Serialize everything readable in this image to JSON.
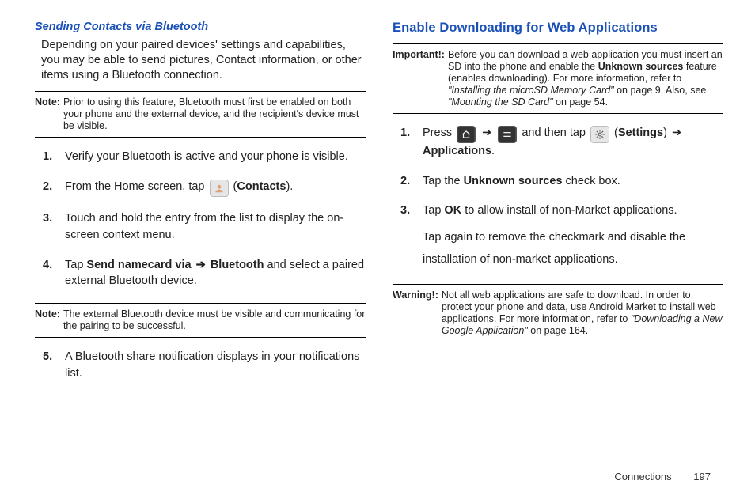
{
  "left": {
    "sub_heading": "Sending Contacts via Bluetooth",
    "intro": "Depending on your paired devices' settings and capabilities, you may be able to send pictures, Contact information, or other items using a Bluetooth connection.",
    "note1_label": "Note:",
    "note1_text": "Prior to using this feature, Bluetooth must first be enabled on both your phone and the external device, and the recipient's device must be visible.",
    "steps": {
      "n1": "1.",
      "s1": "Verify your Bluetooth is active and your phone is visible.",
      "n2": "2.",
      "s2_a": "From the Home screen, tap ",
      "s2_b": " (",
      "s2_bold": "Contacts",
      "s2_c": ").",
      "n3": "3.",
      "s3": "Touch and hold the entry from the list to display the on-screen context menu.",
      "n4": "4.",
      "s4_a": "Tap ",
      "s4_bold1": "Send namecard via",
      "s4_arrow": " ➔ ",
      "s4_bold2": "Bluetooth",
      "s4_b": " and select a paired external Bluetooth device.",
      "n5": "5.",
      "s5": "A Bluetooth share notification displays in your notifications list."
    },
    "note2_label": "Note:",
    "note2_text": "The external Bluetooth device must be visible and communicating for the pairing to be successful."
  },
  "right": {
    "heading": "Enable Downloading for Web Applications",
    "imp_label": "Important!:",
    "imp_a": "Before you can download a web application you must insert an SD into the phone and enable the ",
    "imp_bold1": "Unknown sources",
    "imp_b": " feature (enables downloading). For more information, refer to ",
    "imp_ref1": "\"Installing the microSD Memory Card\"",
    "imp_c": "  on page 9. Also, see ",
    "imp_ref2": "\"Mounting the SD Card\"",
    "imp_d": " on page 54.",
    "steps": {
      "n1": "1.",
      "s1_a": "Press ",
      "s1_arrow1": " ➔ ",
      "s1_b": " and then tap ",
      "s1_paren_open": " (",
      "s1_bold1": "Settings",
      "s1_paren_close": ") ",
      "s1_arrow2": "➔ ",
      "s1_bold2": "Applications",
      "s1_c": ".",
      "n2": "2.",
      "s2_a": "Tap the ",
      "s2_bold": "Unknown sources",
      "s2_b": " check box.",
      "n3": "3.",
      "s3_a": "Tap ",
      "s3_bold": "OK",
      "s3_b": " to allow install of non-Market applications.",
      "s3_c": "Tap again to remove the checkmark and disable the installation of non-market applications."
    },
    "warn_label": "Warning!:",
    "warn_a": "Not all web applications are safe to download. In order to protect your phone and data, use Android Market to install web applications. For more information, refer to ",
    "warn_ref": "\"Downloading a New Google Application\"",
    "warn_b": "  on page 164."
  },
  "footer": {
    "section": "Connections",
    "page": "197"
  }
}
